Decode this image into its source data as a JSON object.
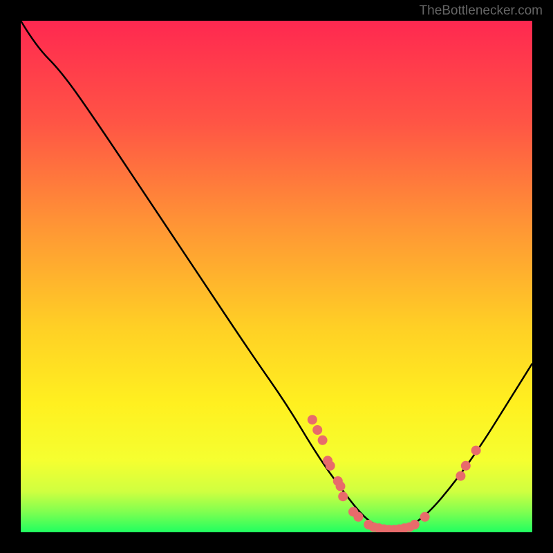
{
  "watermark": "TheBottlenecker.com",
  "chart_data": {
    "type": "line",
    "title": "",
    "xlabel": "",
    "ylabel": "",
    "xlim": [
      0,
      100
    ],
    "ylim": [
      0,
      100
    ],
    "curve_points": [
      {
        "x": 0,
        "y": 100
      },
      {
        "x": 3,
        "y": 95
      },
      {
        "x": 8,
        "y": 90
      },
      {
        "x": 15,
        "y": 80
      },
      {
        "x": 25,
        "y": 65
      },
      {
        "x": 35,
        "y": 50
      },
      {
        "x": 45,
        "y": 35
      },
      {
        "x": 52,
        "y": 25
      },
      {
        "x": 58,
        "y": 15
      },
      {
        "x": 63,
        "y": 8
      },
      {
        "x": 67,
        "y": 3
      },
      {
        "x": 70,
        "y": 1
      },
      {
        "x": 73,
        "y": 0.5
      },
      {
        "x": 76,
        "y": 1
      },
      {
        "x": 80,
        "y": 4
      },
      {
        "x": 85,
        "y": 10
      },
      {
        "x": 90,
        "y": 17
      },
      {
        "x": 95,
        "y": 25
      },
      {
        "x": 100,
        "y": 33
      }
    ],
    "scatter_points": [
      {
        "x": 57,
        "y": 22
      },
      {
        "x": 58,
        "y": 20
      },
      {
        "x": 59,
        "y": 18
      },
      {
        "x": 60,
        "y": 14
      },
      {
        "x": 60.5,
        "y": 13
      },
      {
        "x": 62,
        "y": 10
      },
      {
        "x": 62.5,
        "y": 9
      },
      {
        "x": 63,
        "y": 7
      },
      {
        "x": 65,
        "y": 4
      },
      {
        "x": 66,
        "y": 3
      },
      {
        "x": 68,
        "y": 1.5
      },
      {
        "x": 69,
        "y": 1
      },
      {
        "x": 70,
        "y": 0.8
      },
      {
        "x": 71,
        "y": 0.6
      },
      {
        "x": 72,
        "y": 0.5
      },
      {
        "x": 73,
        "y": 0.5
      },
      {
        "x": 74,
        "y": 0.6
      },
      {
        "x": 75,
        "y": 0.8
      },
      {
        "x": 76,
        "y": 1
      },
      {
        "x": 77,
        "y": 1.5
      },
      {
        "x": 79,
        "y": 3
      },
      {
        "x": 86,
        "y": 11
      },
      {
        "x": 87,
        "y": 13
      },
      {
        "x": 89,
        "y": 16
      }
    ],
    "gradient_colors": {
      "top": "#ff2850",
      "mid1": "#ff6040",
      "mid2": "#ffc020",
      "mid3": "#ffe820",
      "mid4": "#f0ff30",
      "bottom": "#20ff60"
    },
    "scatter_color": "#e86b6b"
  }
}
